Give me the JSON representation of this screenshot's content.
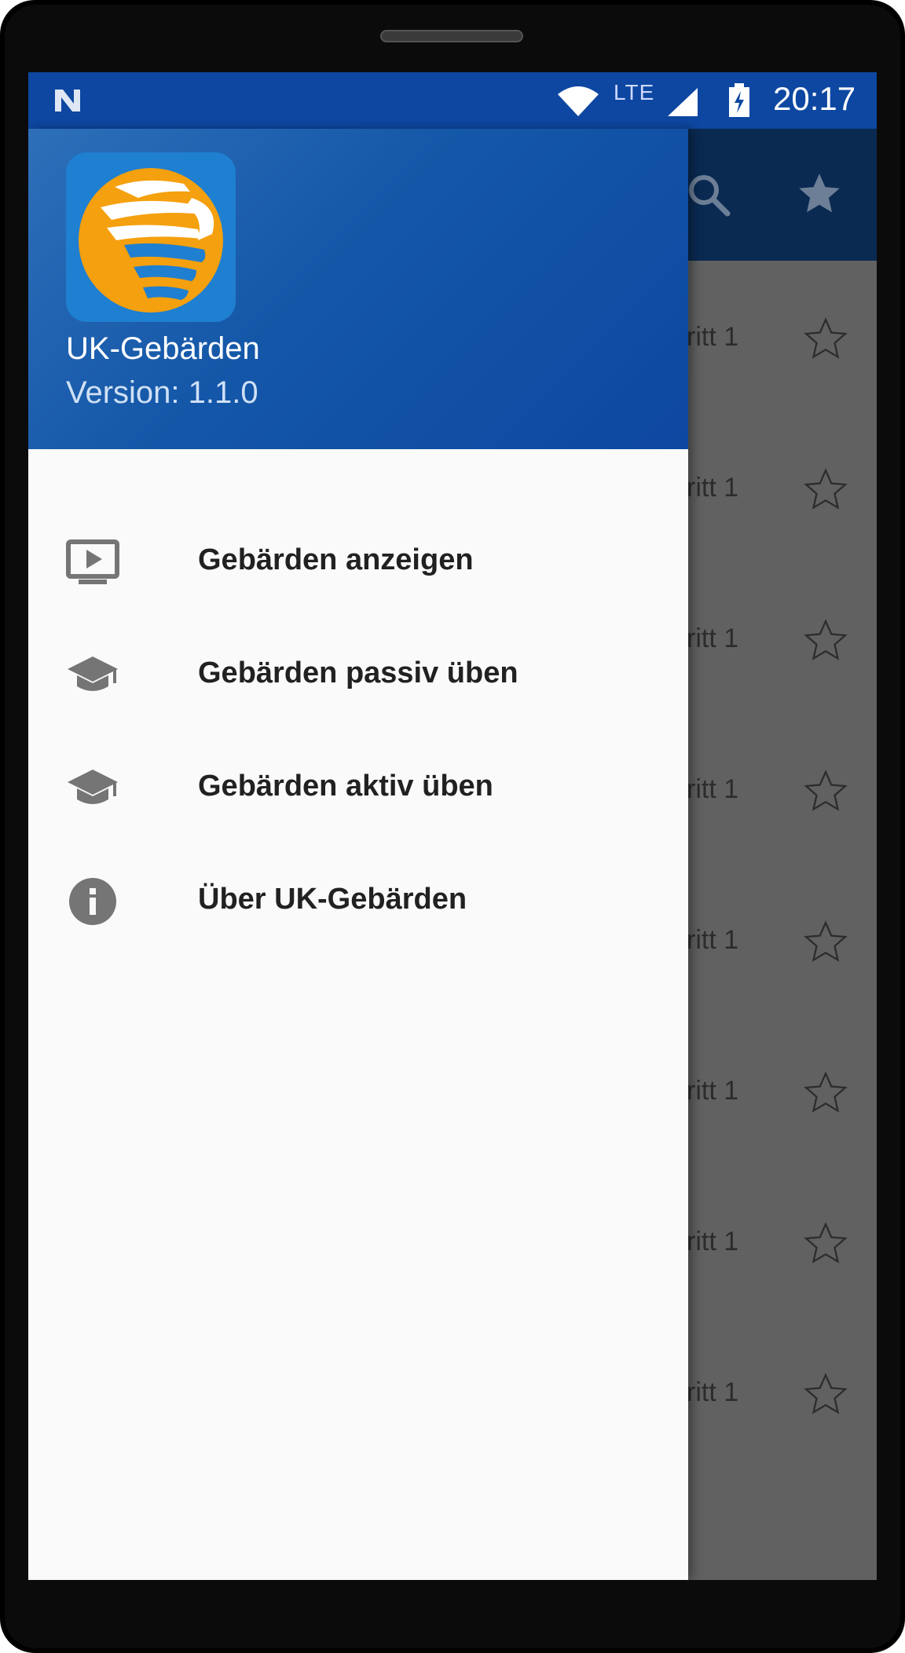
{
  "status_bar": {
    "time": "20:17",
    "network": "LTE"
  },
  "drawer": {
    "app_name": "UK-Gebärden",
    "version": "Version: 1.1.0",
    "menu": [
      {
        "label": "Gebärden anzeigen",
        "icon": "play-monitor-icon"
      },
      {
        "label": "Gebärden passiv üben",
        "icon": "school-cap-icon"
      },
      {
        "label": "Gebärden aktiv üben",
        "icon": "school-cap-icon"
      },
      {
        "label": "Über UK-Gebärden",
        "icon": "info-icon"
      }
    ]
  },
  "background_list": {
    "rows": [
      {
        "text": "ritt  1"
      },
      {
        "text": "ritt  1"
      },
      {
        "text": "ritt  1"
      },
      {
        "text": "ritt  1"
      },
      {
        "text": "ritt  1"
      },
      {
        "text": "ritt  1"
      },
      {
        "text": "ritt  1"
      },
      {
        "text": "ritt  1"
      }
    ]
  },
  "colors": {
    "primary": "#0d47a1",
    "accent": "#f5a623",
    "drawer_bg": "#fafafa"
  }
}
